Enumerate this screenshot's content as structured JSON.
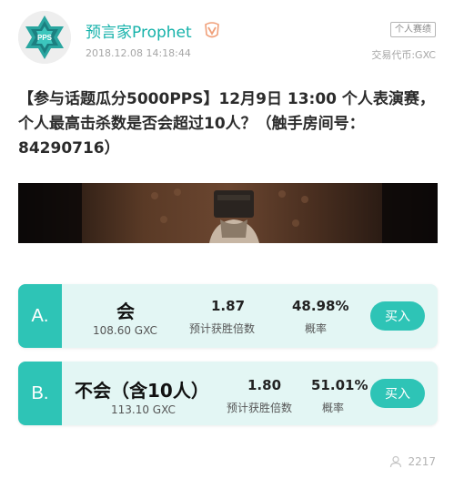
{
  "post": {
    "author": "预言家Prophet",
    "timestamp": "2018.12.08 14:18:44",
    "tag": "个人赛绩",
    "currency": "交易代币:GXC",
    "avatar_text": "PPS",
    "question": "【参与话题瓜分5000PPS】12月9日 13:00 个人表演赛，个人最高击杀数是否会超过10人？（触手房间号：84290716）",
    "views": "2217"
  },
  "options": [
    {
      "letter": "A.",
      "title": "会",
      "amount": "108.60 GXC",
      "odds": "1.87",
      "odds_label": "预计获胜倍数",
      "prob": "48.98%",
      "prob_label": "概率",
      "button": "买入"
    },
    {
      "letter": "B.",
      "title": "不会（含10人）",
      "amount": "113.10 GXC",
      "odds": "1.80",
      "odds_label": "预计获胜倍数",
      "prob": "51.01%",
      "prob_label": "概率",
      "button": "买入"
    }
  ],
  "colors": {
    "accent": "#2ec4b6",
    "author": "#15b2aa",
    "option_bg": "#e3f6f4"
  }
}
